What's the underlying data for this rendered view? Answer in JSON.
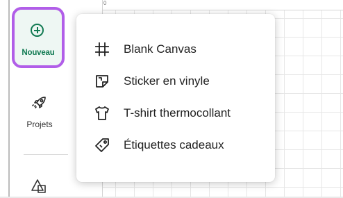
{
  "sidebar": {
    "new_label": "Nouveau",
    "projects_label": "Projets"
  },
  "ruler": {
    "zero": "0"
  },
  "menu": {
    "items": [
      {
        "label": "Blank Canvas",
        "icon": "hash-grid-icon"
      },
      {
        "label": "Sticker en vinyle",
        "icon": "sticker-icon"
      },
      {
        "label": "T-shirt thermocollant",
        "icon": "tshirt-icon"
      },
      {
        "label": "Étiquettes cadeaux",
        "icon": "tag-icon"
      }
    ]
  },
  "colors": {
    "accent_green": "#117a52",
    "highlight_purple": "#b15ee8"
  }
}
